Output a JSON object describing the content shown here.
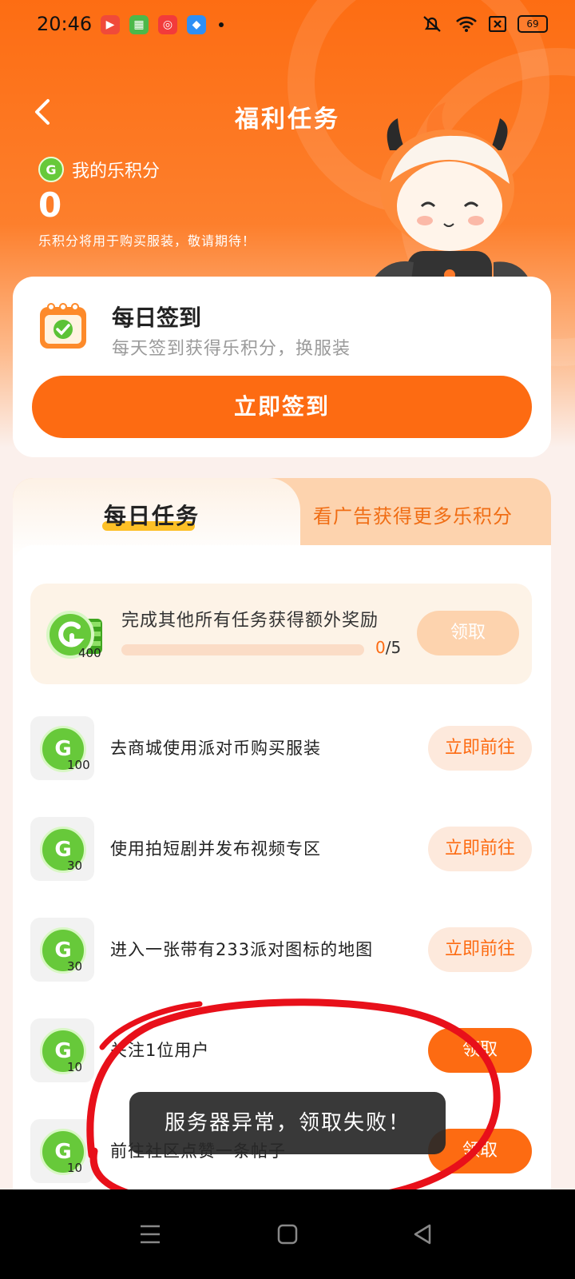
{
  "status_bar": {
    "time": "20:46",
    "battery": "69",
    "app_icons": [
      "video-app-icon",
      "store-app-icon",
      "music-app-icon",
      "notes-app-icon"
    ]
  },
  "header": {
    "title": "福利任务"
  },
  "points": {
    "label": "我的乐积分",
    "value": "0",
    "hint": "乐积分将用于购买服装，敬请期待！"
  },
  "checkin": {
    "title": "每日签到",
    "description": "每天签到获得乐积分，换服装",
    "button": "立即签到"
  },
  "tabs": {
    "active": "每日任务",
    "other": "看广告获得更多乐积分"
  },
  "bonus_task": {
    "title": "完成其他所有任务获得额外奖励",
    "reward": "400",
    "progress_current": "0",
    "progress_total": "/5",
    "progress_fraction": 0,
    "button": "领取"
  },
  "tasks": [
    {
      "text": "去商城使用派对币购买服装",
      "reward": "100",
      "button": "立即前往"
    },
    {
      "text": "使用拍短剧并发布视频专区",
      "reward": "30",
      "button": "立即前往"
    },
    {
      "text": "进入一张带有233派对图标的地图",
      "reward": "30",
      "button": "立即前往"
    },
    {
      "text": "关注1位用户",
      "reward": "10",
      "button": "领取"
    },
    {
      "text": "前往社区点赞一条帖子",
      "reward": "10",
      "button": "领取"
    }
  ],
  "toast": {
    "message": "服务器异常，领取失败！"
  },
  "colors": {
    "brand_orange": "#fd6b12",
    "coin_green": "#67c93a",
    "annotation_red": "#e8101a"
  }
}
